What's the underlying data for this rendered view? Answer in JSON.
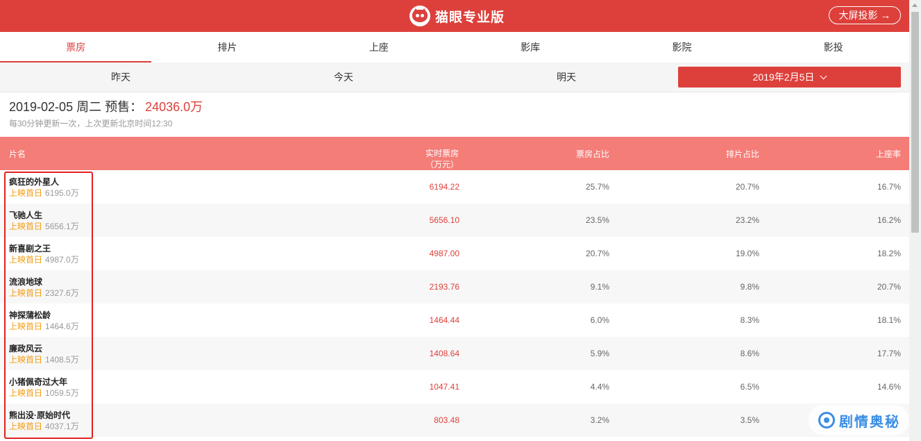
{
  "header": {
    "app_name": "猫眼专业版",
    "bigscreen_label": "大屏投影",
    "bigscreen_arrow": "→",
    "accent": "#dd403b"
  },
  "tabs": [
    {
      "label": "票房",
      "active": true
    },
    {
      "label": "排片",
      "active": false
    },
    {
      "label": "上座",
      "active": false
    },
    {
      "label": "影库",
      "active": false
    },
    {
      "label": "影院",
      "active": false
    },
    {
      "label": "影投",
      "active": false
    }
  ],
  "dates": {
    "yesterday": "昨天",
    "today": "今天",
    "tomorrow": "明天",
    "selected": "2019年2月5日"
  },
  "summary": {
    "date_line": "2019-02-05 周二 预售：",
    "amount": "24036.0万",
    "update_note": "每30分钟更新一次，上次更新北京时间12:30"
  },
  "table": {
    "headers": {
      "name": "片名",
      "realtime_line1": "实时票房",
      "realtime_line2": "（万元）",
      "box_share": "票房占比",
      "show_share": "排片占比",
      "seat_rate": "上座率"
    },
    "rows": [
      {
        "name": "疯狂的外星人",
        "tag": "上映首日",
        "total": "6195.0万",
        "box": "6194.22",
        "box_share": "25.7%",
        "show_share": "20.7%",
        "seat_rate": "16.7%"
      },
      {
        "name": "飞驰人生",
        "tag": "上映首日",
        "total": "5656.1万",
        "box": "5656.10",
        "box_share": "23.5%",
        "show_share": "23.2%",
        "seat_rate": "16.2%"
      },
      {
        "name": "新喜剧之王",
        "tag": "上映首日",
        "total": "4987.0万",
        "box": "4987.00",
        "box_share": "20.7%",
        "show_share": "19.0%",
        "seat_rate": "18.2%"
      },
      {
        "name": "流浪地球",
        "tag": "上映首日",
        "total": "2327.6万",
        "box": "2193.76",
        "box_share": "9.1%",
        "show_share": "9.8%",
        "seat_rate": "20.7%"
      },
      {
        "name": "神探蒲松龄",
        "tag": "上映首日",
        "total": "1464.6万",
        "box": "1464.44",
        "box_share": "6.0%",
        "show_share": "8.3%",
        "seat_rate": "18.1%"
      },
      {
        "name": "廉政风云",
        "tag": "上映首日",
        "total": "1408.5万",
        "box": "1408.64",
        "box_share": "5.9%",
        "show_share": "8.6%",
        "seat_rate": "17.7%"
      },
      {
        "name": "小猪佩奇过大年",
        "tag": "上映首日",
        "total": "1059.5万",
        "box": "1047.41",
        "box_share": "4.4%",
        "show_share": "6.5%",
        "seat_rate": "14.6%"
      },
      {
        "name": "熊出没·原始时代",
        "tag": "上映首日",
        "total": "4037.1万",
        "box": "803.48",
        "box_share": "3.2%",
        "show_share": "3.5%",
        "seat_rate": ""
      }
    ]
  },
  "watermark": {
    "text": "剧情奥秘"
  }
}
